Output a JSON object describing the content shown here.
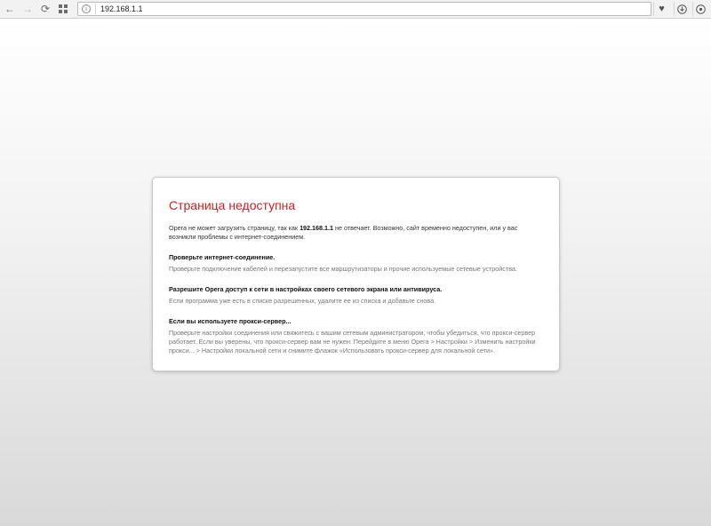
{
  "browser": {
    "address": "192.168.1.1",
    "icons": {
      "back": "arrow-left-icon",
      "forward": "arrow-right-icon",
      "reload": "reload-icon",
      "speed_dial": "grid-icon",
      "site_info": "info-icon",
      "bookmark": "heart-icon",
      "download": "download-icon",
      "menu": "settings-icon"
    }
  },
  "error": {
    "title": "Страница недоступна",
    "intro_pre": "Opera не может загрузить страницу, так как ",
    "intro_host": "192.168.1.1",
    "intro_post": " не отвечает. Возможно, сайт временно недоступен, или у вас возникли проблемы с интернет-соединением.",
    "sections": [
      {
        "title": "Проверьте интернет-соединение.",
        "text": "Проверьте подключение кабелей и перезапустите все маршрутизаторы и прочие используемые сетевые устройства."
      },
      {
        "title": "Разрешите Opera доступ к сети в настройках своего сетевого экрана или антивируса.",
        "text": "Если программа уже есть в списке разрешенных, удалите ее из списка и добавьте снова."
      },
      {
        "title": "Если вы используете прокси-сервер...",
        "text": "Проверьте настройки соединения или свяжитесь с вашим сетевым администратором, чтобы убедиться, что прокси-сервер работает. Если вы уверены, что прокси-сервер вам не нужен: Перейдите в меню Opera > Настройки > Изменить настройки прокси... > Настройки локальной сети и снимите флажок «Использовать прокси-сервер для локальной сети»."
      }
    ]
  },
  "colors": {
    "title_red": "#cc1f1f",
    "muted_text": "#777777"
  }
}
